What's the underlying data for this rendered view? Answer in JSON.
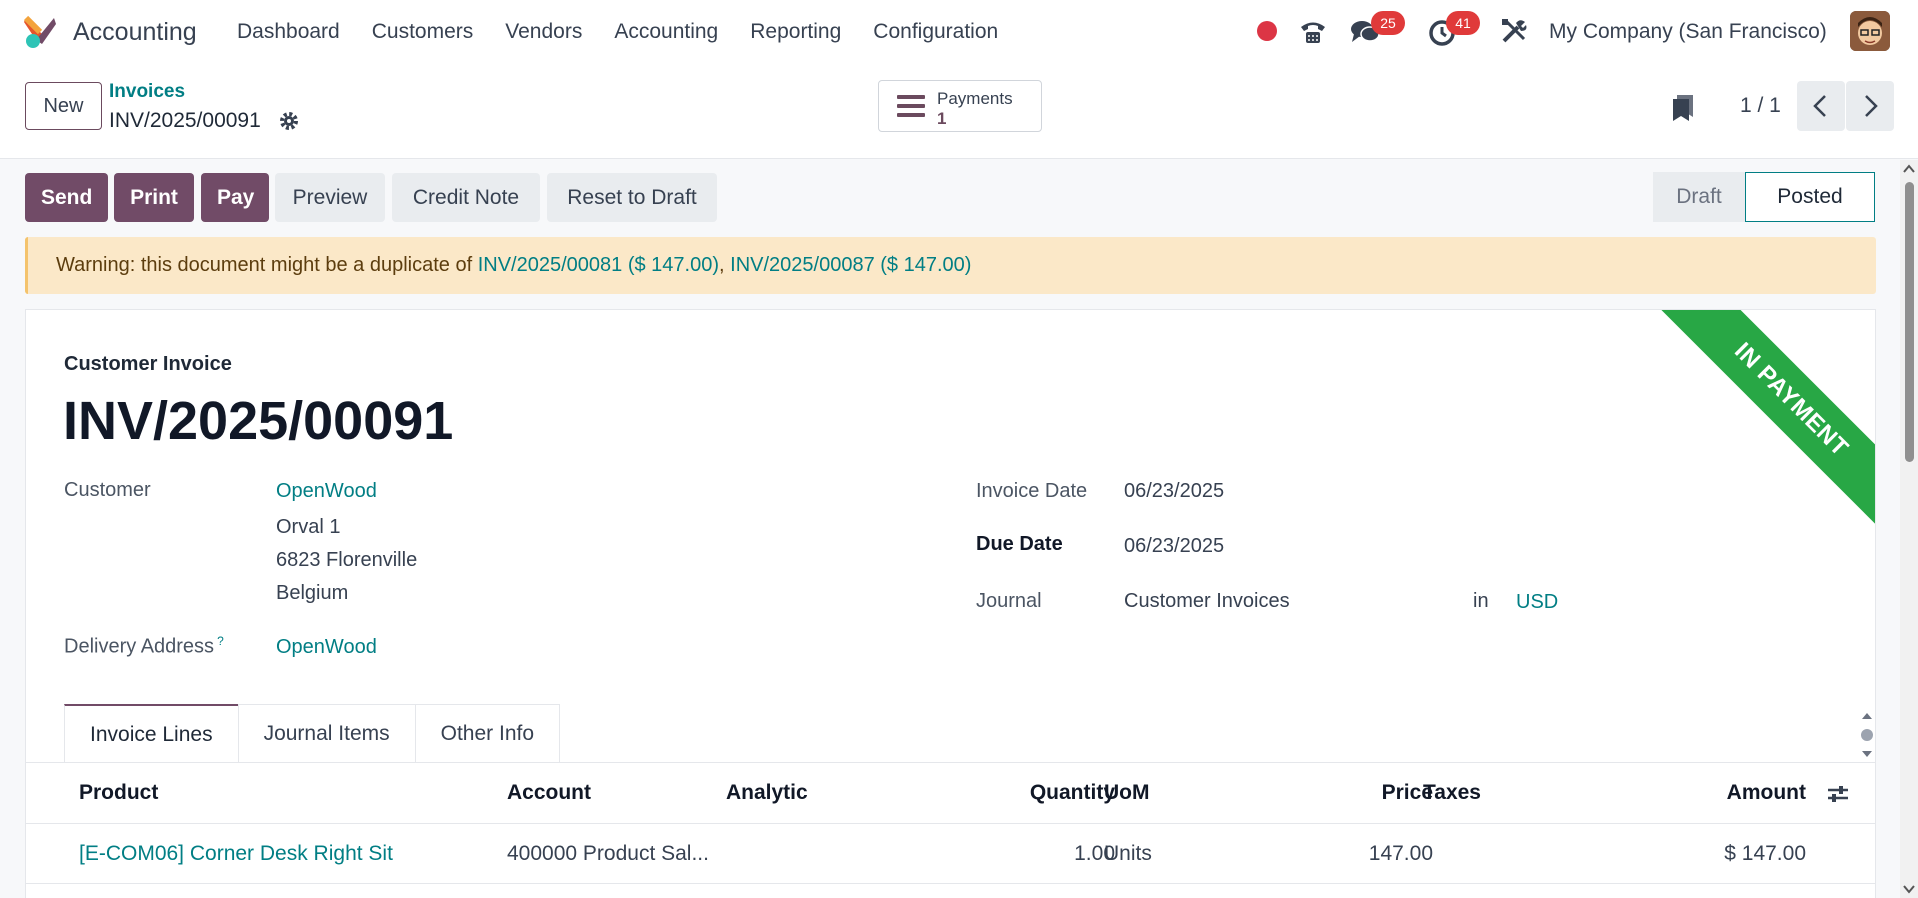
{
  "navbar": {
    "app_name": "Accounting",
    "menu": [
      "Dashboard",
      "Customers",
      "Vendors",
      "Accounting",
      "Reporting",
      "Configuration"
    ],
    "messages_count": "25",
    "activities_count": "41",
    "company": "My Company (San Francisco)"
  },
  "control": {
    "new_label": "New",
    "breadcrumb_parent": "Invoices",
    "breadcrumb_current": "INV/2025/00091",
    "payments_label": "Payments",
    "payments_count": "1",
    "pager": "1 / 1"
  },
  "actions": {
    "send": "Send",
    "print": "Print",
    "pay": "Pay",
    "preview": "Preview",
    "credit_note": "Credit Note",
    "reset_to_draft": "Reset to Draft"
  },
  "status": {
    "draft": "Draft",
    "posted": "Posted"
  },
  "warning": {
    "prefix": "Warning: this document might be a duplicate of ",
    "link1": "INV/2025/00081 ($ 147.00)",
    "sep": ", ",
    "link2": "INV/2025/00087 ($ 147.00)"
  },
  "invoice": {
    "ribbon": "IN PAYMENT",
    "type": "Customer Invoice",
    "name": "INV/2025/00091",
    "customer_label": "Customer",
    "customer": "OpenWood",
    "address_line1": "Orval 1",
    "address_line2": "6823 Florenville",
    "address_line3": "Belgium",
    "delivery_label": "Delivery Address",
    "delivery_help": "?",
    "delivery": "OpenWood",
    "invoice_date_label": "Invoice Date",
    "invoice_date": "06/23/2025",
    "due_date_label": "Due Date",
    "due_date": "06/23/2025",
    "journal_label": "Journal",
    "journal": "Customer Invoices",
    "in_label": "in",
    "currency": "USD"
  },
  "tabs": [
    "Invoice Lines",
    "Journal Items",
    "Other Info"
  ],
  "table": {
    "headers": {
      "product": "Product",
      "account": "Account",
      "analytic": "Analytic",
      "quantity": "Quantity",
      "uom": "UoM",
      "price": "Price",
      "taxes": "Taxes",
      "amount": "Amount"
    },
    "rows": [
      {
        "product": "[E-COM06] Corner Desk Right Sit",
        "account": "400000 Product Sal...",
        "analytic": "",
        "quantity": "1.00",
        "uom": "Units",
        "price": "147.00",
        "taxes": "",
        "amount": "$ 147.00"
      }
    ]
  },
  "colors": {
    "brand": "#714b67",
    "link": "#017e84",
    "ribbon": "#28a745",
    "warning_bg": "#fbe8c8"
  }
}
